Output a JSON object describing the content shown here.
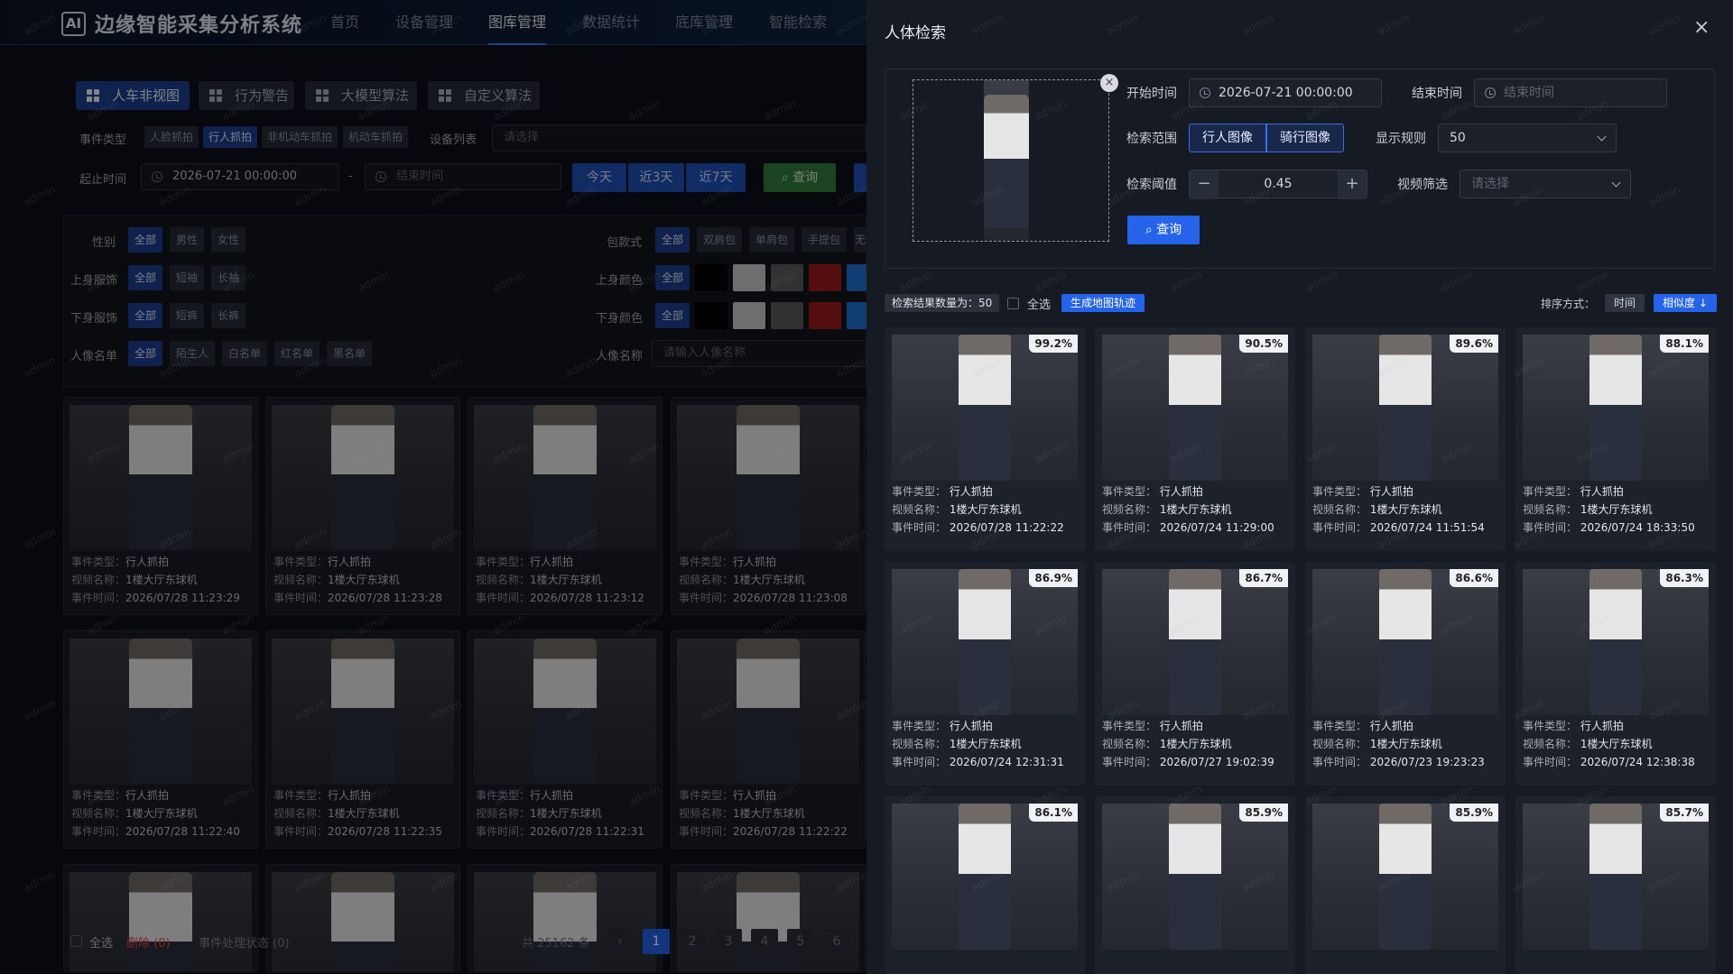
{
  "app": {
    "logo": "AI",
    "title": "边缘智能采集分析系统",
    "nav": [
      "首页",
      "设备管理",
      "图库管理",
      "数据统计",
      "底库管理",
      "智能检索"
    ]
  },
  "tabs": [
    "人车非视图",
    "行为警告",
    "大模型算法",
    "自定义算法"
  ],
  "filters": {
    "event_type_label": "事件类型",
    "event_types": [
      "人脸抓拍",
      "行人抓拍",
      "非机动车抓拍",
      "机动车抓拍"
    ],
    "device_label": "设备列表",
    "device_placeholder": "请选择",
    "time_label": "起止时间",
    "start": "2026-07-21 00:00:00",
    "dash": "-",
    "end_placeholder": "结束时间",
    "quick": [
      "今天",
      "近3天",
      "近7天"
    ],
    "query": "查询",
    "gender_label": "性别",
    "gender": [
      "全部",
      "男性",
      "女性"
    ],
    "upper_label": "上身服饰",
    "upper": [
      "全部",
      "短袖",
      "长袖"
    ],
    "lower_label": "下身服饰",
    "lower": [
      "全部",
      "短裤",
      "长裤"
    ],
    "list_label": "人像名单",
    "lists": [
      "全部",
      "陌生人",
      "白名单",
      "红名单",
      "黑名单"
    ],
    "bag_label": "包款式",
    "bags": [
      "全部",
      "双肩包",
      "单肩包",
      "手提包",
      "无"
    ],
    "upper_color_label": "上身颜色",
    "lower_color_label": "下身颜色",
    "all": "全部",
    "name_label": "人像名称",
    "name_placeholder": "请输入人像名称",
    "colors": [
      "#000000",
      "#c9c9c9",
      "#5b5b5b",
      "#9b1a1a",
      "#1f6fd6"
    ]
  },
  "gallery_labels": {
    "type": "事件类型：",
    "video": "视频名称：",
    "time": "事件时间："
  },
  "gallery": [
    {
      "type": "行人抓拍",
      "video": "1楼大厅东球机",
      "time": "2026/07/28 11:23:29"
    },
    {
      "type": "行人抓拍",
      "video": "1楼大厅东球机",
      "time": "2026/07/28 11:23:28"
    },
    {
      "type": "行人抓拍",
      "video": "1楼大厅东球机",
      "time": "2026/07/28 11:23:12"
    },
    {
      "type": "行人抓拍",
      "video": "1楼大厅东球机",
      "time": "2026/07/28 11:23:08"
    },
    {
      "type": "行人抓拍",
      "video": "1楼大厅东球机",
      "time": "2026/07/28 11:22:40"
    },
    {
      "type": "行人抓拍",
      "video": "1楼大厅东球机",
      "time": "2026/07/28 11:22:35"
    },
    {
      "type": "行人抓拍",
      "video": "1楼大厅东球机",
      "time": "2026/07/28 11:22:31"
    },
    {
      "type": "行人抓拍",
      "video": "1楼大厅东球机",
      "time": "2026/07/28 11:22:22"
    }
  ],
  "footer": {
    "select_all": "全选",
    "delete": "删除",
    "delete_count": "(0)",
    "status": "事件处理状态",
    "status_count": "(0)",
    "total": "共 25162 条",
    "pages": [
      "1",
      "2",
      "3",
      "4",
      "5",
      "6"
    ]
  },
  "panel": {
    "title": "人体检索",
    "start_label": "开始时间",
    "start_value": "2026-07-21 00:00:00",
    "end_label": "结束时间",
    "end_placeholder": "结束时间",
    "scope_label": "检索范围",
    "scope": [
      "行人图像",
      "骑行图像"
    ],
    "rule_label": "显示规则",
    "rule_value": "50",
    "thresh_label": "检索阈值",
    "thresh_value": "0.45",
    "video_label": "视频筛选",
    "video_placeholder": "请选择",
    "query": "查询",
    "result_count": "检索结果数量为：50",
    "select_all": "全选",
    "gen_track": "生成地图轨迹",
    "sort_label": "排序方式：",
    "sort_time": "时间",
    "sort_sim": "相似度 ↓"
  },
  "results": [
    {
      "score": "99.2%",
      "type": "行人抓拍",
      "video": "1楼大厅东球机",
      "time": "2026/07/28 11:22:22"
    },
    {
      "score": "90.5%",
      "type": "行人抓拍",
      "video": "1楼大厅东球机",
      "time": "2026/07/24 11:29:00"
    },
    {
      "score": "89.6%",
      "type": "行人抓拍",
      "video": "1楼大厅东球机",
      "time": "2026/07/24 11:51:54"
    },
    {
      "score": "88.1%",
      "type": "行人抓拍",
      "video": "1楼大厅东球机",
      "time": "2026/07/24 18:33:50"
    },
    {
      "score": "86.9%",
      "type": "行人抓拍",
      "video": "1楼大厅东球机",
      "time": "2026/07/24 12:31:31"
    },
    {
      "score": "86.7%",
      "type": "行人抓拍",
      "video": "1楼大厅东球机",
      "time": "2026/07/27 19:02:39"
    },
    {
      "score": "86.6%",
      "type": "行人抓拍",
      "video": "1楼大厅东球机",
      "time": "2026/07/23 19:23:23"
    },
    {
      "score": "86.3%",
      "type": "行人抓拍",
      "video": "1楼大厅东球机",
      "time": "2026/07/24 12:38:38"
    },
    {
      "score": "86.1%"
    },
    {
      "score": "85.9%"
    },
    {
      "score": "85.9%"
    },
    {
      "score": "85.7%"
    }
  ],
  "result_labels": {
    "type": "事件类型：",
    "video": "视频名称：",
    "time": "事件时间："
  },
  "watermark": "admin"
}
